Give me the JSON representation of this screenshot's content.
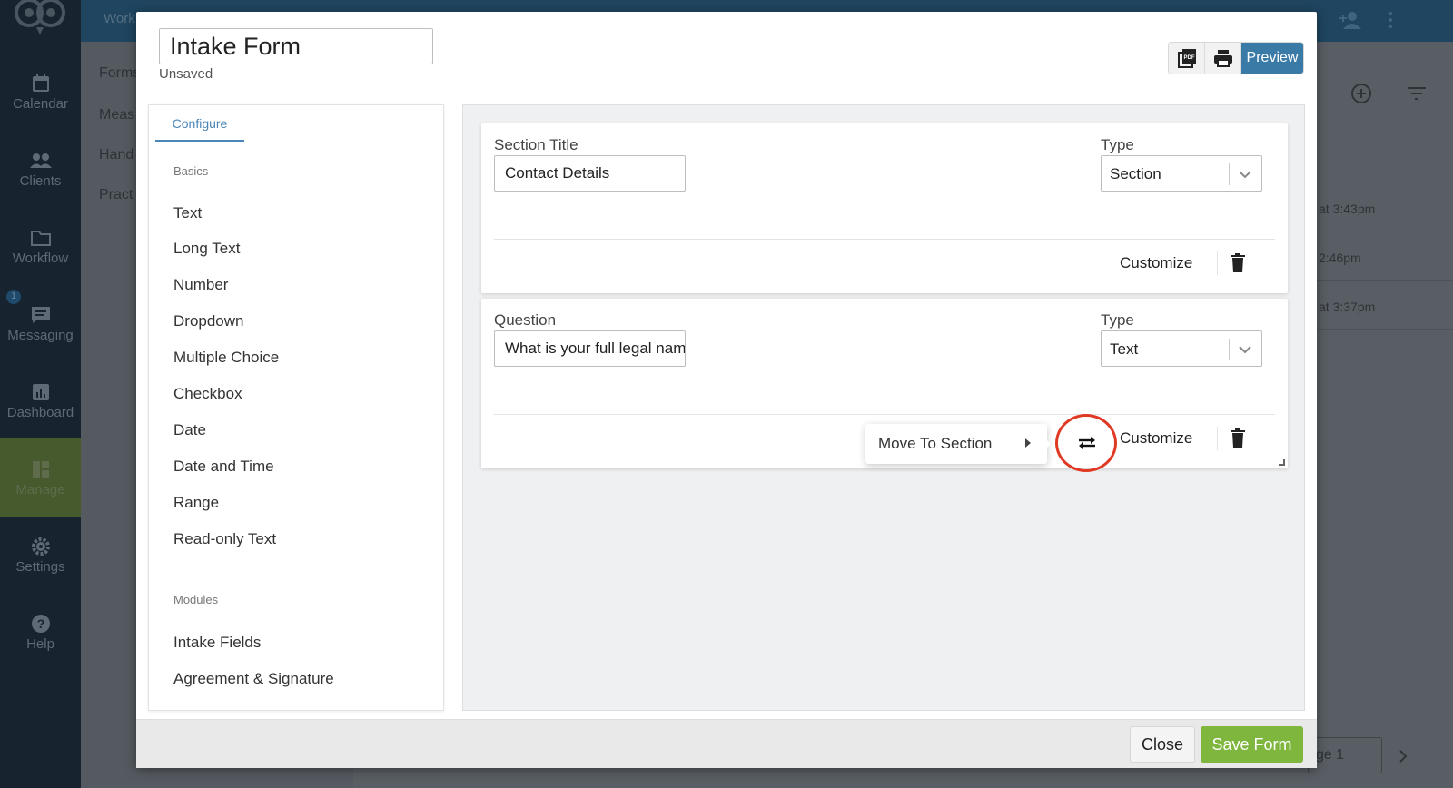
{
  "app": {
    "topbar_text": "Work",
    "nav": [
      {
        "label": "Calendar",
        "icon": "calendar-icon"
      },
      {
        "label": "Clients",
        "icon": "clients-icon"
      },
      {
        "label": "Workflow",
        "icon": "folder-icon"
      },
      {
        "label": "Messaging",
        "icon": "message-icon",
        "badge": "1"
      },
      {
        "label": "Dashboard",
        "icon": "chart-icon"
      },
      {
        "label": "Manage",
        "icon": "manage-icon"
      },
      {
        "label": "Settings",
        "icon": "gear-icon"
      },
      {
        "label": "Help",
        "icon": "help-icon"
      }
    ],
    "subnav": [
      "Forms",
      "Meas",
      "Hand",
      "Pract"
    ],
    "bg_times": [
      "at 3:43pm",
      "2:46pm",
      "at 3:37pm"
    ],
    "pager_text": "ge 1"
  },
  "modal": {
    "title_value": "Intake Form",
    "status": "Unsaved",
    "preview_label": "Preview",
    "palette": {
      "tab": "Configure",
      "basics_heading": "Basics",
      "basics": [
        "Text",
        "Long Text",
        "Number",
        "Dropdown",
        "Multiple Choice",
        "Checkbox",
        "Date",
        "Date and Time",
        "Range",
        "Read-only Text"
      ],
      "modules_heading": "Modules",
      "modules": [
        "Intake Fields",
        "Agreement & Signature"
      ]
    },
    "cards": [
      {
        "field_label": "Section Title",
        "field_value": "Contact Details",
        "type_label": "Type",
        "type_value": "Section",
        "customize": "Customize"
      },
      {
        "field_label": "Question",
        "field_value": "What is your full legal name?",
        "type_label": "Type",
        "type_value": "Text",
        "customize": "Customize"
      }
    ],
    "move_menu_label": "Move To Section",
    "footer": {
      "close": "Close",
      "save": "Save Form"
    }
  },
  "colors": {
    "accent_blue": "#3a7aa7",
    "save_green": "#7eb63e",
    "highlight_red": "#e03a25"
  }
}
